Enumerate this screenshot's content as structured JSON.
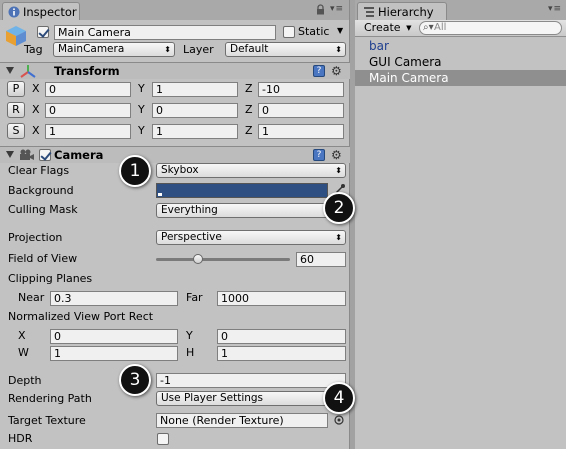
{
  "inspector": {
    "tab_label": "Inspector",
    "object_name": "Main Camera",
    "static_label": "Static",
    "tag_label": "Tag",
    "tag_value": "MainCamera",
    "layer_label": "Layer",
    "layer_value": "Default",
    "transform": {
      "title": "Transform",
      "rows": [
        {
          "button": "P",
          "x": "0",
          "y": "1",
          "z": "-10"
        },
        {
          "button": "R",
          "x": "0",
          "y": "0",
          "z": "0"
        },
        {
          "button": "S",
          "x": "1",
          "y": "1",
          "z": "1"
        }
      ],
      "axis_x": "X",
      "axis_y": "Y",
      "axis_z": "Z"
    },
    "camera": {
      "title": "Camera",
      "clear_flags_label": "Clear Flags",
      "clear_flags_value": "Skybox",
      "background_label": "Background",
      "background_color": "#2e4f82",
      "culling_mask_label": "Culling Mask",
      "culling_mask_value": "Everything",
      "projection_label": "Projection",
      "projection_value": "Perspective",
      "fov_label": "Field of View",
      "fov_value": "60",
      "fov_slider_fraction": 0.3,
      "clipping_label": "Clipping Planes",
      "near_label": "Near",
      "near_value": "0.3",
      "far_label": "Far",
      "far_value": "1000",
      "viewport_label": "Normalized View Port Rect",
      "vp_x_label": "X",
      "vp_x_value": "0",
      "vp_y_label": "Y",
      "vp_y_value": "0",
      "vp_w_label": "W",
      "vp_w_value": "1",
      "vp_h_label": "H",
      "vp_h_value": "1",
      "depth_label": "Depth",
      "depth_value": "-1",
      "rendering_path_label": "Rendering Path",
      "rendering_path_value": "Use Player Settings",
      "target_texture_label": "Target Texture",
      "target_texture_value": "None (Render Texture)",
      "hdr_label": "HDR"
    }
  },
  "hierarchy": {
    "tab_label": "Hierarchy",
    "create_label": "Create",
    "search_placeholder": "All",
    "items": [
      "bar",
      "GUI Camera",
      "Main Camera"
    ],
    "selected_index": 2
  },
  "callouts": [
    "1",
    "2",
    "3",
    "4"
  ],
  "icons": {
    "inspector_tab": "info-icon",
    "hierarchy_tab": "list-icon",
    "transform": "axes-icon",
    "camera": "camera-icon",
    "help": "help-icon",
    "settings": "gear-icon",
    "lock": "lock-icon",
    "eyedropper": "eyedropper-icon",
    "object_picker": "target-icon"
  }
}
